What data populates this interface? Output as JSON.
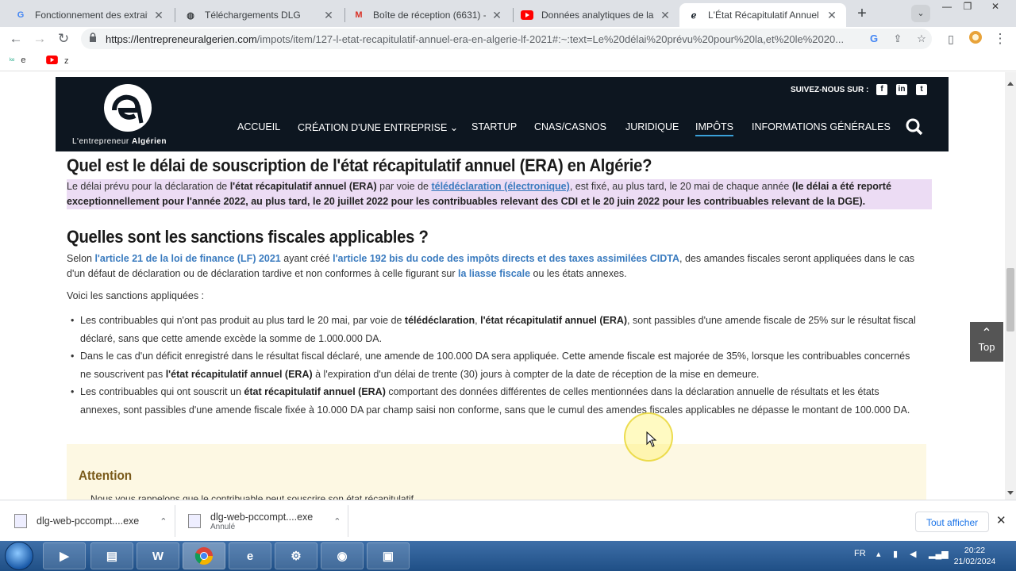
{
  "browser": {
    "tabs": [
      {
        "label": "Fonctionnement des extraits d",
        "icon": "google-icon",
        "active": false
      },
      {
        "label": "Téléchargements DLG",
        "icon": "globe-icon",
        "active": false
      },
      {
        "label": "Boîte de réception (6631) - co",
        "icon": "gmail-icon",
        "active": false
      },
      {
        "label": "Données analytiques de la cha",
        "icon": "youtube-icon",
        "active": false
      },
      {
        "label": "L'État Récapitulatif Annuel (ER",
        "icon": "site-logo-icon",
        "active": true
      }
    ],
    "new_tab": "+",
    "url_domain": "https://lentrepreneuralgerien.com",
    "url_path": "/impots/item/127-l-etat-recapitulatif-annuel-era-en-algerie-lf-2021#:~:text=Le%20délai%20prévu%20pour%20la,et%20le%2020...",
    "bookmarks": [
      {
        "label": "e",
        "icon": "ke-icon"
      },
      {
        "label": "z",
        "icon": "youtube-icon"
      }
    ]
  },
  "site": {
    "logo_text_normal": "L'entrepreneur ",
    "logo_text_bold": "Algérien",
    "follow_label": "SUIVEZ-NOUS SUR :",
    "social": [
      "facebook-icon",
      "linkedin-icon",
      "twitter-icon"
    ],
    "nav": [
      {
        "label": "ACCUEIL",
        "active": false
      },
      {
        "label": "CRÉATION D'UNE ENTREPRISE ⌄",
        "active": false
      },
      {
        "label": "STARTUP",
        "active": false
      },
      {
        "label": "CNAS/CASNOS",
        "active": false
      },
      {
        "label": "JURIDIQUE",
        "active": false
      },
      {
        "label": "IMPÔTS",
        "active": true
      },
      {
        "label": "INFORMATIONS GÉNÉRALES",
        "active": false
      }
    ]
  },
  "article": {
    "heading1": "Quel est le délai de souscription de l'état récapitulatif annuel (ERA) en Algérie?",
    "p1": {
      "a": "Le délai prévu pour la déclaration de ",
      "b": "l'état récapitulatif annuel (ERA)",
      "c": " par voie de ",
      "link": "télédéclaration (électronique)",
      "d": ", est fixé, au plus tard, le 20 mai de chaque année ",
      "e": "(le délai a été reporté exceptionnellement pour l'année 2022, au plus tard, le 20 juillet 2022 pour les contribuables relevant des CDI et le 20 juin 2022",
      "f": " pour les contribuables relevant de la DGE)."
    },
    "heading2": "Quelles sont les sanctions fiscales applicables ?",
    "p2": {
      "a": "Selon ",
      "link1": "l'article 21 de la loi de finance (LF) 2021",
      "b": " ayant créé ",
      "link2": "l'article 192 bis du code des impôts directs et des taxes assimilées CIDTA",
      "c": ", des amandes fiscales seront appliquées dans le cas d'un défaut de déclaration ou de déclaration tardive et non conformes à celle figurant sur ",
      "link3": "la liasse fiscale",
      "d": " ou les états annexes."
    },
    "p3": "Voici les sanctions appliquées :",
    "bullets": [
      {
        "a": "Les contribuables qui n'ont pas produit au plus tard le 20 mai, par voie de ",
        "b1": "télédéclaration",
        "m": ", ",
        "b2": "l'état récapitulatif annuel (ERA)",
        "c": ", sont passibles d'une amende fiscale de 25% sur le résultat fiscal déclaré, sans que cette amende excède la somme de 1.000.000 DA."
      },
      {
        "a": "Dans le cas d'un déficit enregistré dans le résultat fiscal déclaré, une amende de 100.000 DA sera appliquée. Cette amende fiscale est majorée de 35%, lorsque les contribuables concernés ne souscrivent pas ",
        "b1": "l'état récapitulatif annuel (ERA)",
        "c": " à l'expiration d'un délai de trente (30) jours à compter de la date de réception de la mise en demeure."
      },
      {
        "a": "Les contribuables qui ont souscrit un ",
        "b1": "état récapitulatif annuel (ERA)",
        "c": " comportant des données différentes de celles mentionnées dans la déclaration annuelle de résultats et les états annexes, sont passibles d'une amende fiscale fixée à 10.000 DA par champ saisi non conforme, sans que le cumul des amendes fiscales applicables ne dépasse le montant de 100.000 DA."
      }
    ],
    "attention_title": "Attention",
    "attention_text": "Nous vous rappelons que le contribuable peut souscrire son état récapitulatif..."
  },
  "top_button": "Top",
  "downloads": [
    {
      "name": "dlg-web-pccompt....exe",
      "status": ""
    },
    {
      "name": "dlg-web-pccompt....exe",
      "status": "Annulé"
    }
  ],
  "show_all": "Tout afficher",
  "taskbar": {
    "lang": "FR",
    "time": "20:22",
    "date": "21/02/2024"
  }
}
